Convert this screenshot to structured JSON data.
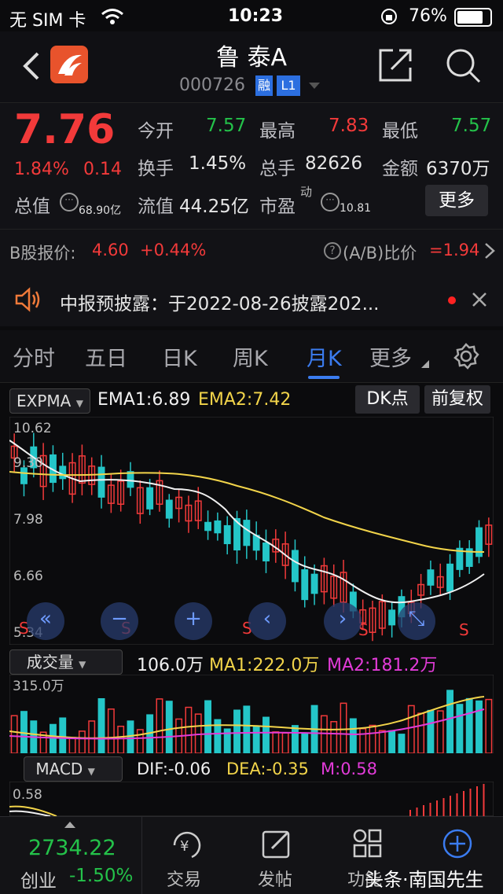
{
  "status_bar": {
    "carrier": "无 SIM 卡",
    "time": "10:23",
    "battery": "76%"
  },
  "header": {
    "title": "鲁 泰A",
    "code": "000726",
    "badge_rong": "融",
    "badge_l1": "L1"
  },
  "summary": {
    "price": "7.76",
    "change_pct": "1.84%",
    "change": "0.14",
    "open_label": "今开",
    "open": "7.57",
    "high_label": "最高",
    "high": "7.83",
    "low_label": "最低",
    "low": "7.57",
    "turnover_label": "换手",
    "turnover": "1.45%",
    "volume_label": "总手",
    "volume": "82626",
    "amount_label": "金额",
    "amount": "6370万",
    "mktcap_label": "总值",
    "mktcap": "68.90亿",
    "float_label": "流值",
    "float_cap": "44.25亿",
    "pe_label": "市盈",
    "pe_sup": "动",
    "pe": "10.81",
    "more_button": "更多"
  },
  "bprice": {
    "label": "B股报价:",
    "price": "4.60",
    "change": "+0.44%",
    "ratio_label": "(A/B)比价",
    "ratio": "=1.94"
  },
  "notice": {
    "text": "中报预披露：于2022-08-26披露202..."
  },
  "tabs": [
    "分时",
    "五日",
    "日K",
    "周K",
    "月K",
    "更多"
  ],
  "active_tab": "月K",
  "indicator": {
    "selector": "EXPMA",
    "ema1": "EMA1:6.89",
    "ema2": "EMA2:7.42",
    "dk_button": "DK点",
    "fq_button": "前复权"
  },
  "price_axis": [
    "10.62",
    "9.30",
    "7.98",
    "6.66",
    "5.34"
  ],
  "volume_bar": {
    "selector": "成交量",
    "value": "106.0万",
    "ma1": "MA1:222.0万",
    "ma2": "MA2:181.2万",
    "axis_top": "315.0万"
  },
  "macd_bar": {
    "selector": "MACD",
    "dif": "DIF:-0.06",
    "dea": "DEA:-0.35",
    "m": "M:0.58",
    "axis_top": "0.58"
  },
  "s_marks": [
    "S",
    "S",
    "S",
    "S",
    "S"
  ],
  "footer": {
    "index_value": "2734.22",
    "index_name": "创业",
    "index_change": "-1.50%",
    "trade": "交易",
    "post": "发帖",
    "func": "功能",
    "watermark": "头条·南国先生"
  },
  "colors": {
    "up": "#f23a3a",
    "down": "#24c6c8",
    "ema1": "#f0f0f0",
    "ema2": "#f2d44a",
    "ma2": "#e23bd8",
    "accent": "#3b7cf0"
  },
  "icons": [
    "back-icon",
    "app-logo-icon",
    "share-icon",
    "search-icon",
    "speaker-icon",
    "close-icon",
    "settings-icon",
    "help-icon",
    "chevron-right-icon",
    "trade-icon",
    "post-icon",
    "function-icon",
    "add-icon"
  ]
}
